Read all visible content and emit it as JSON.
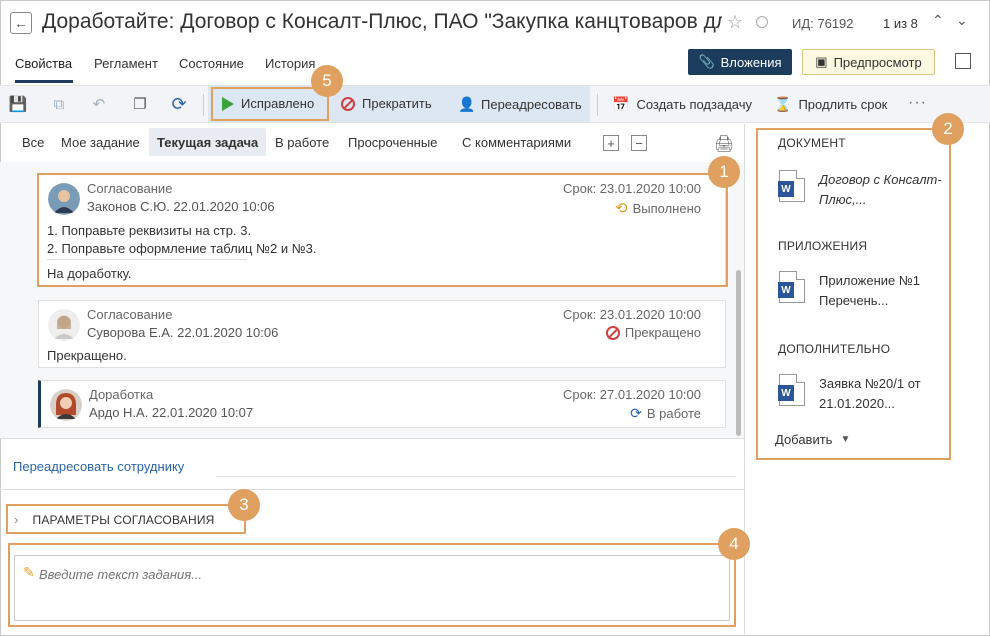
{
  "header": {
    "title": "Доработайте: Договор с Консалт-Плюс, ПАО \"Закупка канцтоваров для ...",
    "doc_id": "ИД: 76192",
    "pager": "1 из 8"
  },
  "tabs": [
    {
      "label": "Свойства",
      "active": true
    },
    {
      "label": "Регламент"
    },
    {
      "label": "Состояние"
    },
    {
      "label": "История"
    }
  ],
  "header_buttons": {
    "attachments": "Вложения",
    "preview": "Предпросмотр"
  },
  "toolbar": {
    "fixed": "Исправлено",
    "stop": "Прекратить",
    "redirect": "Переадресовать",
    "create_subtask": "Создать подзадачу",
    "extend": "Продлить срок",
    "more": "···"
  },
  "filters": [
    {
      "label": "Все"
    },
    {
      "label": "Мое задание"
    },
    {
      "label": "Текущая задача",
      "active": true
    },
    {
      "label": "В работе"
    },
    {
      "label": "Просроченные"
    },
    {
      "label": "С комментариями"
    }
  ],
  "tasks": [
    {
      "kind": "Согласование",
      "author": "Законов С.Ю.  22.01.2020 10:06",
      "due": "Срок: 23.01.2020 10:00",
      "status": "Выполнено",
      "lines": [
        "1. Поправьте реквизиты на стр. 3.",
        "2. Поправьте оформление таблиц №2 и №3."
      ],
      "comment": "На доработку."
    },
    {
      "kind": "Согласование",
      "author": "Суворова Е.А.  22.01.2020 10:06",
      "due": "Срок: 23.01.2020 10:00",
      "status": "Прекращено",
      "comment": "Прекращено."
    },
    {
      "kind": "Доработка",
      "author": "Ардо Н.А.  22.01.2020 10:07",
      "due": "Срок: 27.01.2020 10:00",
      "status": "В работе"
    }
  ],
  "redirect_link": "Переадресовать сотруднику",
  "params_label": "ПАРАМЕТРЫ СОГЛАСОВАНИЯ",
  "task_input": {
    "placeholder": "Введите текст задания..."
  },
  "right_panel": {
    "document_head": "ДОКУМЕНТ",
    "document_name": "Договор с Консалт-Плюс,...",
    "attachments_head": "ПРИЛОЖЕНИЯ",
    "attachment_name": "Приложение №1 Перечень...",
    "extra_head": "ДОПОЛНИТЕЛЬНО",
    "extra_name": "Заявка №20/1 от 21.01.2020...",
    "add_label": "Добавить",
    "word_letter": "W"
  },
  "callouts": [
    "1",
    "2",
    "3",
    "4",
    "5"
  ],
  "colors": {
    "accent": "#1c3c5e",
    "callout": "#e0a060",
    "link": "#2a64a8"
  }
}
